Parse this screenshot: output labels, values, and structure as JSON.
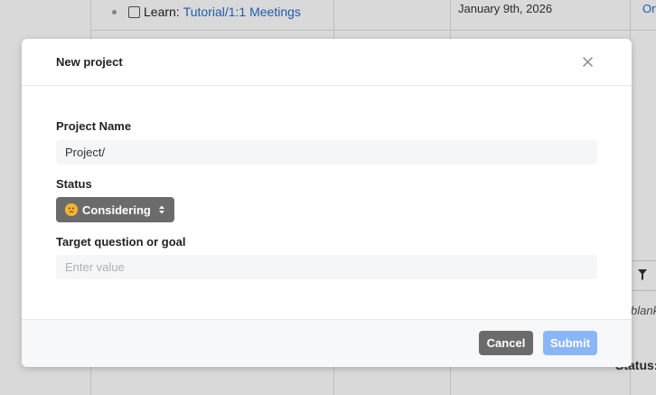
{
  "background": {
    "task": {
      "prefix": "Learn:",
      "link": "Tutorial/1:1 Meetings"
    },
    "date": "January 9th, 2026",
    "right_link_fragment": "On",
    "blank_fragment": "blank",
    "status_fragment": "Status:"
  },
  "modal": {
    "title": "New project",
    "project_name": {
      "label": "Project Name",
      "value": "Project/"
    },
    "status": {
      "label": "Status",
      "value": "Considering",
      "icon": "thinking-face-icon"
    },
    "target": {
      "label": "Target question or goal",
      "placeholder": "Enter value"
    },
    "cancel_label": "Cancel",
    "submit_label": "Submit"
  },
  "colors": {
    "overlay": "#000000",
    "cancel_button": "#6b6b6b",
    "status_select": "#6b6b6b",
    "submit_button_disabled": "#8ab6f8",
    "link": "#2a6ac8"
  }
}
